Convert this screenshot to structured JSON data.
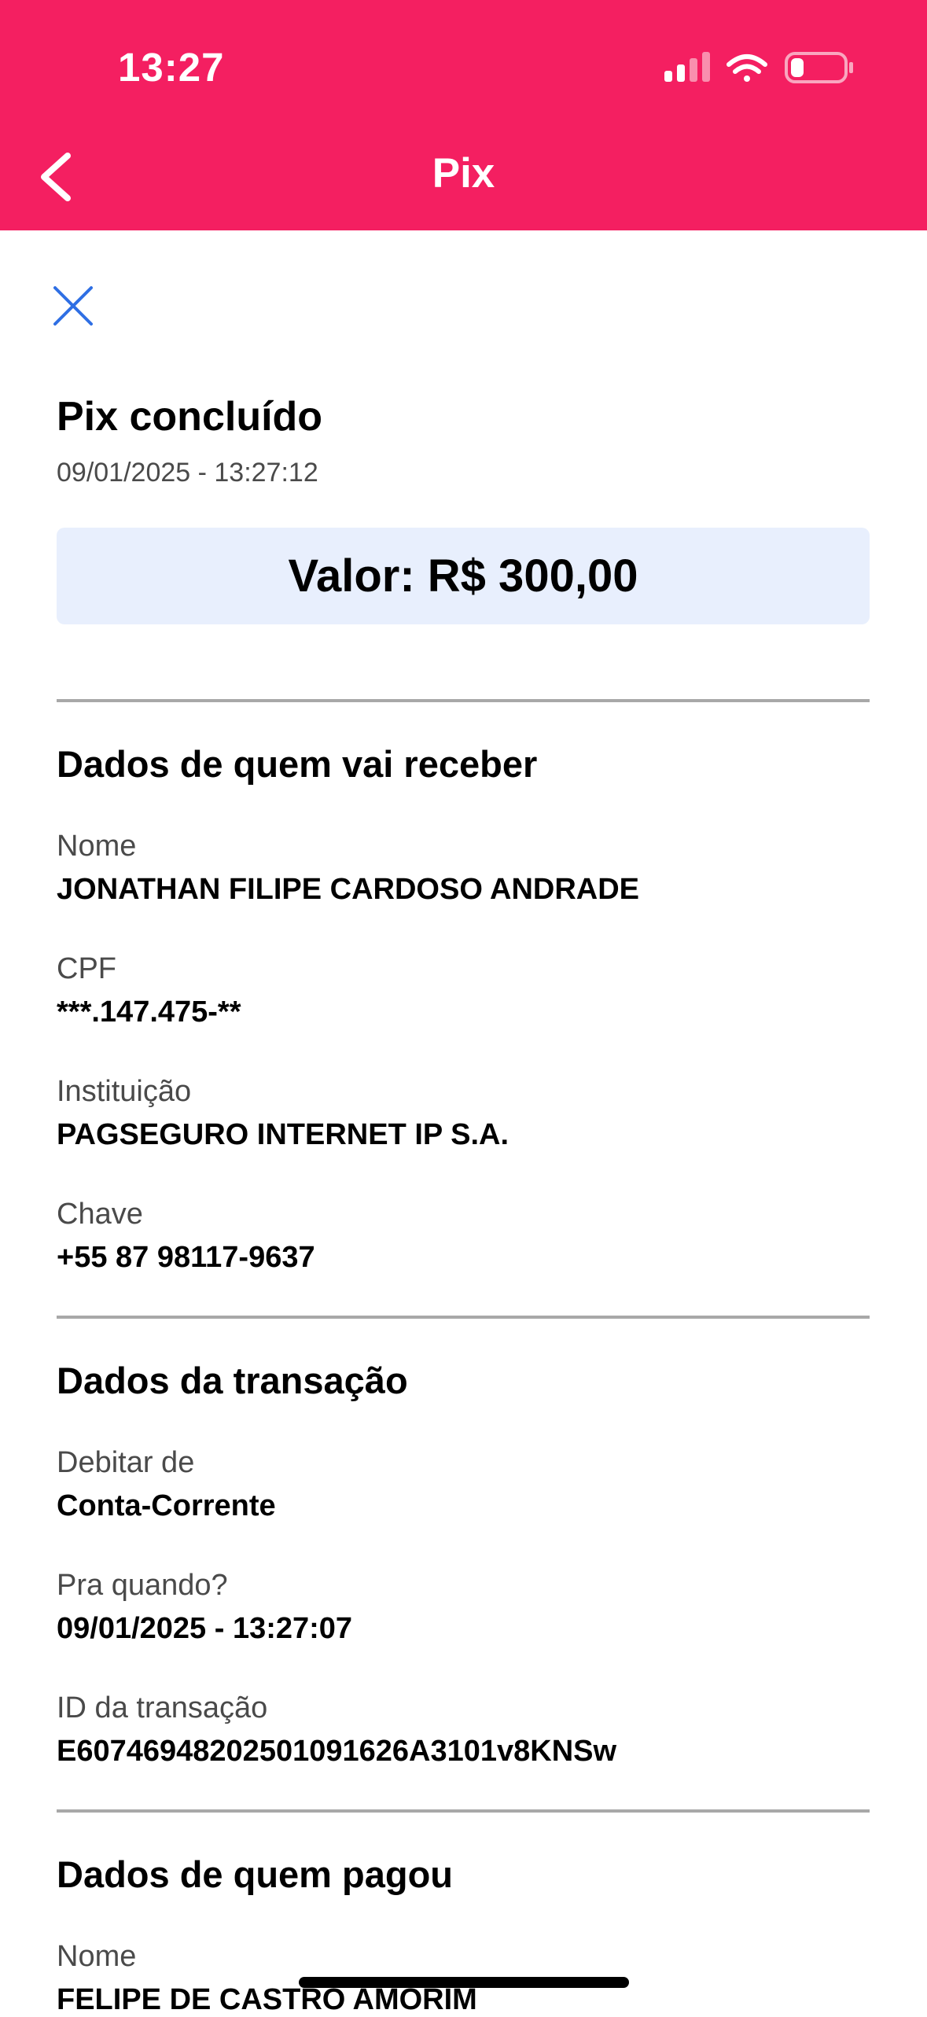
{
  "status_bar": {
    "time": "13:27"
  },
  "header": {
    "title": "Pix"
  },
  "receipt": {
    "title": "Pix concluído",
    "datetime": "09/01/2025 - 13:27:12",
    "amount": "Valor: R$ 300,00"
  },
  "recipient": {
    "heading": "Dados de quem vai receber",
    "fields": [
      {
        "label": "Nome",
        "value": "JONATHAN FILIPE CARDOSO ANDRADE"
      },
      {
        "label": "CPF",
        "value": "***.147.475-**"
      },
      {
        "label": "Instituição",
        "value": "PAGSEGURO INTERNET IP S.A."
      },
      {
        "label": "Chave",
        "value": "+55 87 98117-9637"
      }
    ]
  },
  "transaction": {
    "heading": "Dados da transação",
    "fields": [
      {
        "label": "Debitar de",
        "value": "Conta-Corrente"
      },
      {
        "label": "Pra quando?",
        "value": "09/01/2025 - 13:27:07"
      },
      {
        "label": "ID da transação",
        "value": "E60746948202501091626A3101v8KNSw"
      }
    ]
  },
  "payer": {
    "heading": "Dados de quem pagou",
    "fields": [
      {
        "label": "Nome",
        "value": "FELIPE DE CASTRO AMORIM"
      }
    ]
  },
  "colors": {
    "brand": "#f41f61",
    "amount_bg": "#e8effd",
    "close_icon": "#2f6fe4",
    "divider": "#a8a8a8"
  },
  "icons": [
    "cellular-signal-icon",
    "wifi-icon",
    "battery-icon",
    "back-arrow-icon",
    "close-icon"
  ]
}
